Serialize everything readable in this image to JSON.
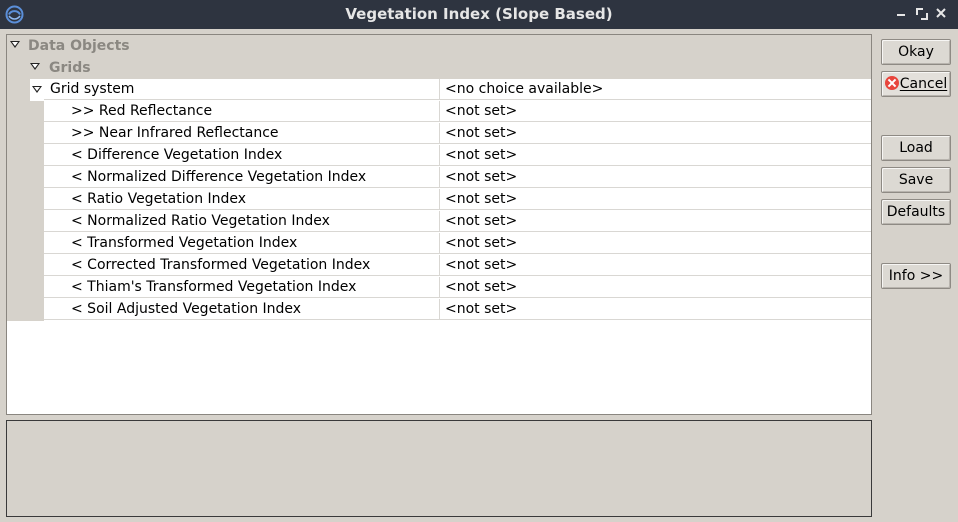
{
  "window": {
    "title": "Vegetation Index (Slope Based)"
  },
  "tree": {
    "root_label": "Data Objects",
    "group_label": "Grids",
    "grid_system": {
      "name": "Grid system",
      "value": "<no choice available>"
    },
    "parameters": [
      {
        "name": ">> Red Reflectance",
        "value": "<not set>"
      },
      {
        "name": ">> Near Infrared Reflectance",
        "value": "<not set>"
      },
      {
        "name": "< Difference Vegetation Index",
        "value": "<not set>"
      },
      {
        "name": "< Normalized Difference Vegetation Index",
        "value": "<not set>"
      },
      {
        "name": "< Ratio Vegetation Index",
        "value": "<not set>"
      },
      {
        "name": "< Normalized Ratio Vegetation Index",
        "value": "<not set>"
      },
      {
        "name": "< Transformed Vegetation Index",
        "value": "<not set>"
      },
      {
        "name": "< Corrected Transformed Vegetation Index",
        "value": "<not set>"
      },
      {
        "name": "< Thiam's Transformed Vegetation Index",
        "value": "<not set>"
      },
      {
        "name": "< Soil Adjusted Vegetation Index",
        "value": "<not set>"
      }
    ]
  },
  "buttons": {
    "okay": "Okay",
    "cancel": "Cancel",
    "load": "Load",
    "save": "Save",
    "defaults": "Defaults",
    "info": "Info >>"
  },
  "icons": {
    "app": "saga-app-icon",
    "minimize": "minimize-icon",
    "maximize": "maximize-icon",
    "close": "close-icon",
    "cancel": "cancel-icon"
  },
  "colors": {
    "titlebar": "#2e3440",
    "background": "#d6d2cb",
    "section_text": "#8b8882",
    "cancel_icon": "#e8453c"
  }
}
